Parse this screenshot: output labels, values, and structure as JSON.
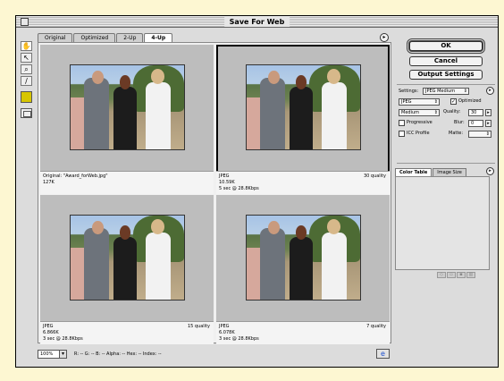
{
  "window": {
    "title": "Save For Web"
  },
  "tabs": [
    "Original",
    "Optimized",
    "2-Up",
    "4-Up"
  ],
  "active_tab": "4-Up",
  "tools": [
    "hand-tool-icon",
    "slice-select-tool-icon",
    "zoom-tool-icon",
    "eyedropper-tool-icon"
  ],
  "colors": {
    "eyedropper_swatch": "#d7c600",
    "background": "#fdf7d2",
    "window": "#dcdcdc"
  },
  "panes": [
    {
      "line1": "Original: \"Award_forWeb.jpg\"",
      "line2": "127K",
      "line3": "",
      "quality": "",
      "selected": false
    },
    {
      "line1": "JPEG",
      "line2": "10.59K",
      "line3": "5 sec @ 28.8Kbps",
      "quality": "30 quality",
      "selected": true
    },
    {
      "line1": "JPEG",
      "line2": "6.866K",
      "line3": "3 sec @ 28.8Kbps",
      "quality": "15 quality",
      "selected": false
    },
    {
      "line1": "JPEG",
      "line2": "6.078K",
      "line3": "3 sec @ 28.8Kbps",
      "quality": "7 quality",
      "selected": false
    }
  ],
  "status": {
    "zoom": "100%",
    "readout": "R: --   G: --   B: --   Alpha: --   Hex: --   Index: --"
  },
  "buttons": {
    "ok": "OK",
    "cancel": "Cancel",
    "output_settings": "Output Settings"
  },
  "settings": {
    "label": "Settings:",
    "preset": "JPEG Medium",
    "format": "JPEG",
    "optimized_label": "Optimized",
    "optimized": true,
    "quality_level": "Medium",
    "quality_label": "Quality:",
    "quality_value": "30",
    "progressive_label": "Progressive",
    "progressive": false,
    "blur_label": "Blur:",
    "blur_value": "0",
    "icc_label": "ICC Profile",
    "icc": false,
    "matte_label": "Matte:",
    "matte_value": ""
  },
  "panel_tabs": [
    "Color Table",
    "Image Size"
  ],
  "active_panel_tab": "Color Table"
}
